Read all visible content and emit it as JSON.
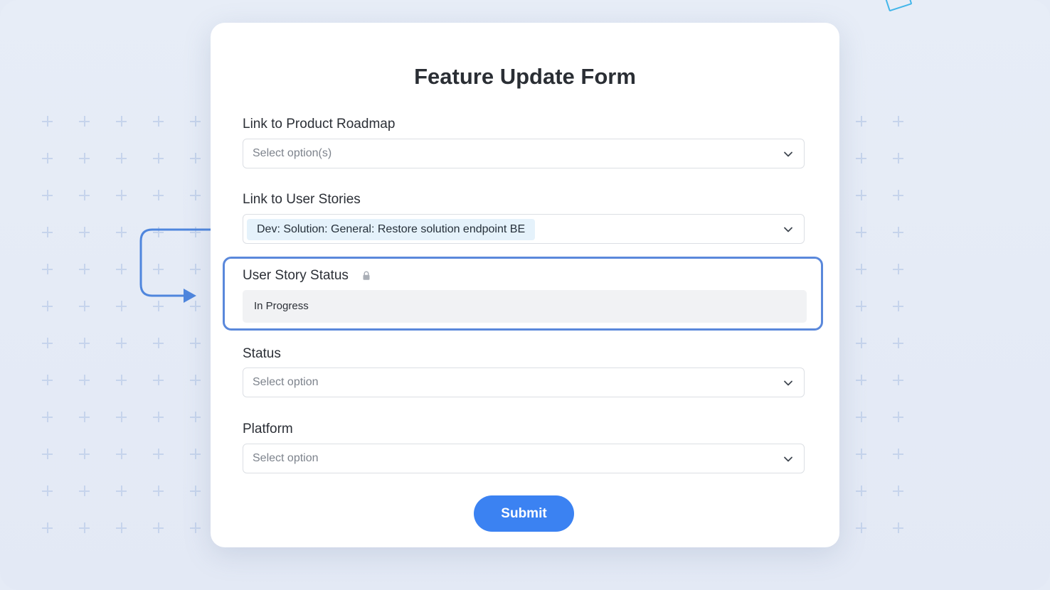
{
  "form": {
    "title": "Feature Update Form",
    "fields": [
      {
        "label": "Link to Product Roadmap",
        "type": "multi-select",
        "placeholder": "Select option(s)"
      },
      {
        "label": "Link to User Stories",
        "type": "multi-select",
        "selected_tag": "Dev: Solution: General: Restore solution endpoint BE"
      },
      {
        "label": "User Story Status",
        "type": "read-only",
        "value": "In Progress",
        "locked": true,
        "icon": "lock-icon"
      },
      {
        "label": "Status",
        "type": "select",
        "placeholder": "Select option"
      },
      {
        "label": "Platform",
        "type": "select",
        "placeholder": "Select option"
      }
    ],
    "submit_label": "Submit"
  },
  "colors": {
    "accent": "#3b82f2",
    "highlight_border": "#5a88db",
    "tag_background": "#e5f2fb",
    "readonly_background": "#f1f2f4",
    "page_background": "#e5ebf6"
  }
}
